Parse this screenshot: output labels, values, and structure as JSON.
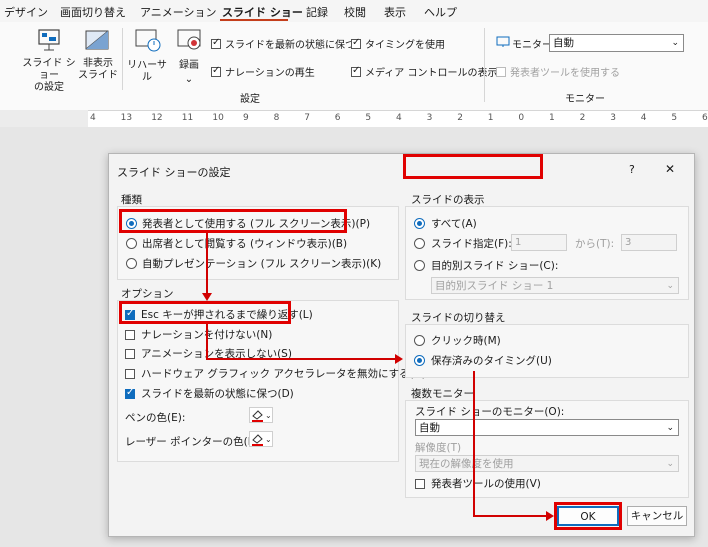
{
  "tabs": [
    "デザイン",
    "画面切り替え",
    "アニメーション",
    "スライド ショー",
    "記録",
    "校閲",
    "表示",
    "ヘルプ"
  ],
  "ribbon": {
    "setup_label": "スライド ショー\nの設定",
    "hide_label": "非表示\nスライド",
    "rehearse_label": "リハーサル",
    "record_label": "録画",
    "keep_updated": "スライドを最新の状態に保つ",
    "play_narration": "ナレーションの再生",
    "use_timings": "タイミングを使用",
    "media_controls": "メディア コントロールの表示",
    "group_setup": "設定",
    "monitor_label": "モニター:",
    "monitor_value": "自動",
    "presenter_view": "発表者ツールを使用する",
    "group_monitor": "モニター"
  },
  "ruler": [
    "4",
    "13",
    "12",
    "11",
    "10",
    "9",
    "8",
    "7",
    "6",
    "5",
    "4",
    "3",
    "2",
    "1",
    "0",
    "1",
    "2",
    "3",
    "4",
    "5",
    "6"
  ],
  "dialog": {
    "title": "スライド ショーの設定",
    "help": "?",
    "close": "✕",
    "type_group": "種類",
    "type_options": [
      "発表者として使用する (フル スクリーン表示)(P)",
      "出席者として閲覧する (ウィンドウ表示)(B)",
      "自動プレゼンテーション (フル スクリーン表示)(K)"
    ],
    "options_group": "オプション",
    "options": [
      "Esc キーが押されるまで繰り返す(L)",
      "ナレーションを付けない(N)",
      "アニメーションを表示しない(S)",
      "ハードウェア グラフィック アクセラレータを無効にする(G)",
      "スライドを最新の状態に保つ(D)"
    ],
    "pen_color": "ペンの色(E):",
    "laser_color": "レーザー ポインターの色(R):",
    "show_group": "スライドの表示",
    "show_all": "すべて(A)",
    "show_range": "スライド指定(F):",
    "range_from": "1",
    "range_to_label": "から(T):",
    "range_to": "3",
    "custom_show": "目的別スライド ショー(C):",
    "custom_show_value": "目的別スライド ショー 1",
    "advance_group": "スライドの切り替え",
    "advance_manual": "クリック時(M)",
    "advance_timings": "保存済みのタイミング(U)",
    "monitors_group": "複数モニター",
    "monitor_label": "スライド ショーのモニター(O):",
    "monitor_value": "自動",
    "resolution_label": "解像度(T)",
    "resolution_value": "現在の解像度を使用",
    "presenter_view": "発表者ツールの使用(V)",
    "ok": "OK",
    "cancel": "キャンセル"
  },
  "colors": {
    "accent": "#0f6cbd",
    "highlight": "#e00000",
    "tab_underline": "#c43e1c"
  }
}
